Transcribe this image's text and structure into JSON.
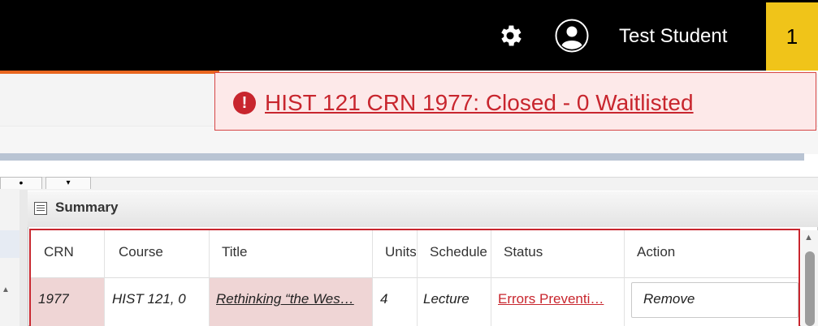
{
  "header": {
    "user_name": "Test Student",
    "badge_count": "1",
    "icons": [
      "gear-icon",
      "user-avatar-icon"
    ]
  },
  "alert": {
    "icon": "exclamation-circle-icon",
    "icon_glyph": "!",
    "message": "HIST 121 CRN 1977: Closed - 0 Waitlisted"
  },
  "tabs": {
    "dot": "•",
    "dropdown": "▾"
  },
  "summary": {
    "title": "Summary",
    "columns": [
      "CRN",
      "Course",
      "Title",
      "Units",
      "Schedule",
      "Status",
      "Action"
    ],
    "rows": [
      {
        "crn": "1977",
        "course": "HIST 121, 0",
        "title": "Rethinking “the Wes…",
        "units": "4",
        "schedule": "Lecture",
        "status": "Errors Preventi…",
        "action": "Remove"
      }
    ]
  },
  "colors": {
    "header_bg": "#000000",
    "badge_bg": "#f0c419",
    "alert_bg": "#fde9e9",
    "alert_text": "#c8262e",
    "accent_orange": "#e8661f"
  }
}
